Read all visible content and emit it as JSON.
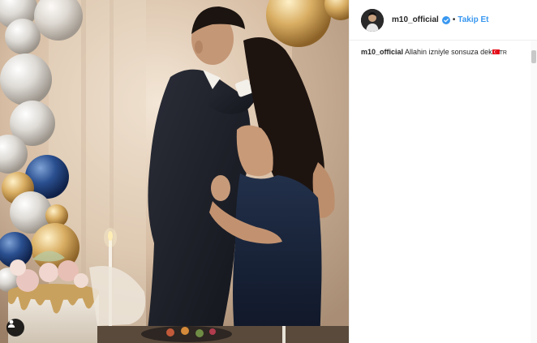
{
  "post": {
    "username": "m10_official",
    "separator": "•",
    "follow_label": "Takip Et",
    "caption_user": "m10_official",
    "caption_text": "Allahin izniyle sonsuza dek",
    "caption_flag_text": "TR"
  },
  "colors": {
    "follow_blue": "#3897f0",
    "verified_blue": "#3897f0",
    "text_dark": "#262626"
  },
  "icons": {
    "user_tag": "user-tag-icon",
    "verified": "verified-badge-icon"
  }
}
